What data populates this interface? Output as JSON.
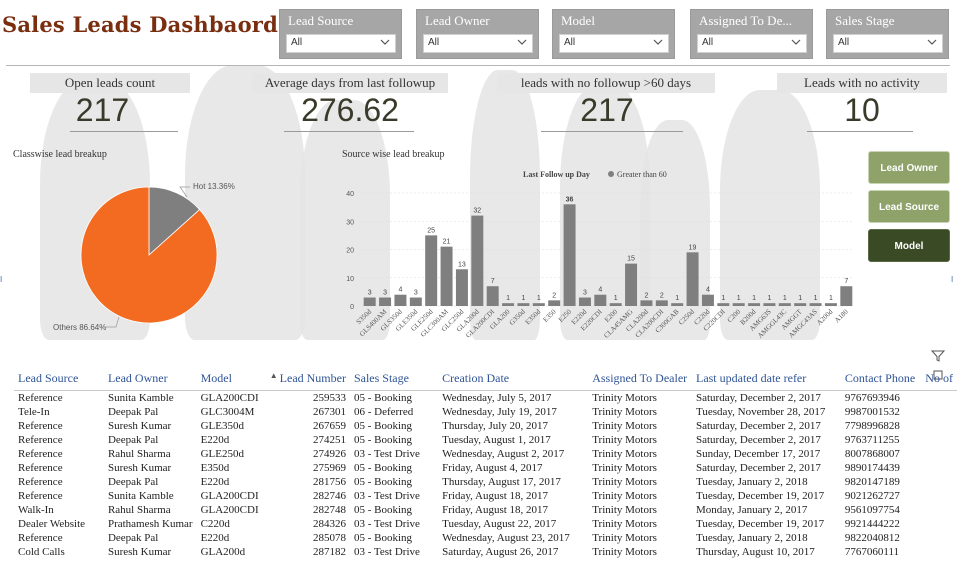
{
  "header": {
    "title": "Sales Leads Dashbaord"
  },
  "filters": [
    {
      "label": "Lead Source",
      "value": "All"
    },
    {
      "label": "Lead Owner",
      "value": "All"
    },
    {
      "label": "Model",
      "value": "All"
    },
    {
      "label": "Assigned To De...",
      "value": "All"
    },
    {
      "label": "Sales Stage",
      "value": "All"
    }
  ],
  "kpis": [
    {
      "label": "Open leads count",
      "value": "217"
    },
    {
      "label": "Average days from last followup",
      "value": "276.62"
    },
    {
      "label": "leads with no followup >60 days",
      "value": "217"
    },
    {
      "label": "Leads with no activity",
      "value": "10"
    }
  ],
  "side_buttons": [
    "Lead Owner",
    "Lead Source",
    "Model"
  ],
  "edge_marks": {
    "left": "I",
    "right": "I"
  },
  "pie": {
    "section_title": "Classwise lead breakup",
    "labels": [
      "Hot 13.36%",
      "Others 86.64%"
    ]
  },
  "chart_data": [
    {
      "type": "pie",
      "title": "Classwise lead breakup",
      "categories": [
        "Hot",
        "Others"
      ],
      "values": [
        13.36,
        86.64
      ],
      "colors": [
        "#7f7f7f",
        "#f26b21"
      ]
    },
    {
      "type": "bar",
      "title": "Source wise lead breakup",
      "legend_title": "Last Follow up Day",
      "series_name": "Greater than 60",
      "color": "#7f7f7f",
      "ylim": [
        0,
        40
      ],
      "yticks": [
        0,
        10,
        20,
        30,
        40
      ],
      "grid": true,
      "categories": [
        "S350d",
        "GLS400AM",
        "GLS350d",
        "GLE350d",
        "GLE250d",
        "GLC300AM",
        "GLC250d",
        "GLA200d",
        "GLA200CDI",
        "GLA200",
        "G350d",
        "E350d",
        "E350",
        "E250",
        "E220d",
        "E220CDI",
        "E200",
        "CLA45AMG",
        "CLA200d",
        "CLA200CDI",
        "C300GAB",
        "C250d",
        "C220d",
        "C220CDI",
        "C200",
        "B200d",
        "AMG63S",
        "AMGGL43C",
        "AMGGT",
        "AMGC43AS",
        "A200d",
        "A180"
      ],
      "values": [
        3,
        3,
        4,
        3,
        25,
        21,
        13,
        32,
        7,
        1,
        1,
        1,
        2,
        36,
        3,
        4,
        1,
        15,
        2,
        2,
        1,
        19,
        4,
        1,
        1,
        1,
        1,
        1,
        1,
        1,
        1,
        7
      ]
    }
  ],
  "table": {
    "columns": [
      "Lead Source",
      "Lead Owner",
      "Model",
      "Lead Number",
      "Sales Stage",
      "Creation Date",
      "Assigned To Dealer",
      "Last updated date refer",
      "Contact Phone",
      "No of"
    ],
    "sort_column": "Lead Number",
    "rows": [
      [
        "Reference",
        "Sunita Kamble",
        "GLA200CDI",
        "259533",
        "05 - Booking",
        "Wednesday, July 5, 2017",
        "Trinity Motors",
        "Saturday, December 2, 2017",
        "9767693946"
      ],
      [
        "Tele-In",
        "Deepak Pal",
        "GLC3004M",
        "267301",
        "06 - Deferred",
        "Wednesday, July 19, 2017",
        "Trinity Motors",
        "Tuesday, November 28, 2017",
        "9987001532"
      ],
      [
        "Reference",
        "Suresh Kumar",
        "GLE350d",
        "267659",
        "05 - Booking",
        "Thursday, July 20, 2017",
        "Trinity Motors",
        "Saturday, December 2, 2017",
        "7798996828"
      ],
      [
        "Reference",
        "Deepak Pal",
        "E220d",
        "274251",
        "05 - Booking",
        "Tuesday, August 1, 2017",
        "Trinity Motors",
        "Saturday, December 2, 2017",
        "9763711255"
      ],
      [
        "Reference",
        "Rahul Sharma",
        "GLE250d",
        "274926",
        "03 - Test Drive",
        "Wednesday, August 2, 2017",
        "Trinity Motors",
        "Sunday, December 17, 2017",
        "8007868007"
      ],
      [
        "Reference",
        "Suresh Kumar",
        "E350d",
        "275969",
        "05 - Booking",
        "Friday, August 4, 2017",
        "Trinity Motors",
        "Saturday, December 2, 2017",
        "9890174439"
      ],
      [
        "Reference",
        "Deepak Pal",
        "E220d",
        "281756",
        "05 - Booking",
        "Thursday, August 17, 2017",
        "Trinity Motors",
        "Tuesday, January 2, 2018",
        "9820147189"
      ],
      [
        "Reference",
        "Sunita Kamble",
        "GLA200CDI",
        "282746",
        "03 - Test Drive",
        "Friday, August 18, 2017",
        "Trinity Motors",
        "Tuesday, December 19, 2017",
        "9021262727"
      ],
      [
        "Walk-In",
        "Rahul Sharma",
        "GLA200CDI",
        "282748",
        "05 - Booking",
        "Friday, August 18, 2017",
        "Trinity Motors",
        "Monday, January 2, 2017",
        "9561097754"
      ],
      [
        "Dealer Website",
        "Prathamesh Kumar",
        "C220d",
        "284326",
        "03 - Test Drive",
        "Tuesday, August 22, 2017",
        "Trinity Motors",
        "Tuesday, December 19, 2017",
        "9921444222"
      ],
      [
        "Reference",
        "Deepak Pal",
        "E220d",
        "285078",
        "05 - Booking",
        "Wednesday, August 23, 2017",
        "Trinity Motors",
        "Tuesday, January 2, 2018",
        "9822040812"
      ],
      [
        "Cold Calls",
        "Suresh Kumar",
        "GLA200d",
        "287182",
        "03 - Test Drive",
        "Saturday, August 26, 2017",
        "Trinity Motors",
        "Thursday, August 10, 2017",
        "7767060111"
      ]
    ]
  }
}
